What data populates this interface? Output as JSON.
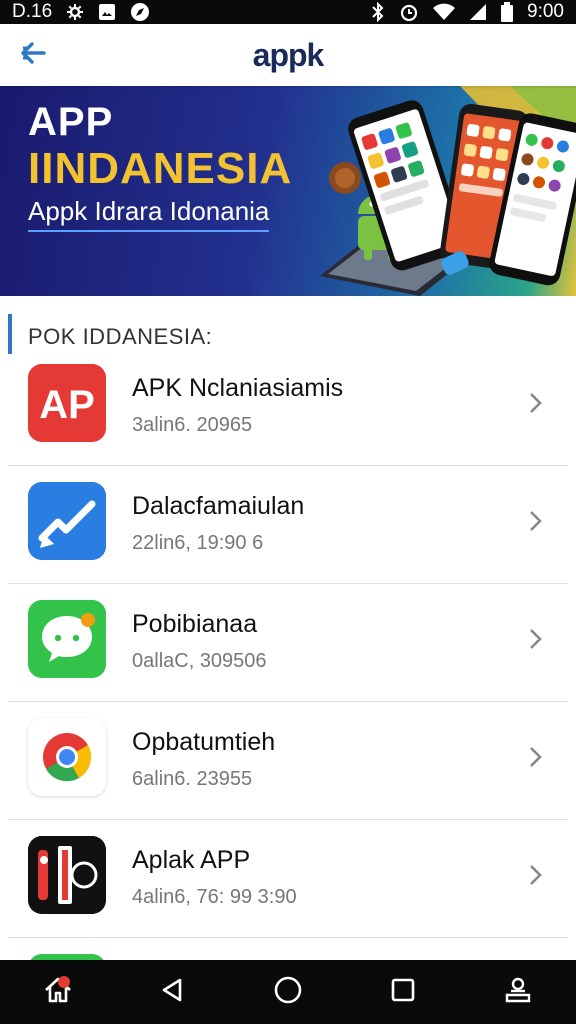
{
  "status_bar": {
    "time_left": "D.16",
    "time_right": "9:00",
    "left_icons": [
      "gear-icon",
      "image-icon",
      "compass-icon"
    ],
    "right_icons": [
      "bluetooth-icon",
      "alarm-icon",
      "wifi-icon",
      "signal-icon",
      "battery-icon"
    ]
  },
  "app_bar": {
    "title": "appk",
    "back_icon": "back-arrow-icon"
  },
  "banner": {
    "title_line1": "APP",
    "title_line2": "IINDANESIA",
    "subtitle": "Appk Idrara Idonania",
    "colors": {
      "title_line2": "#f3c230",
      "background_start": "#1a1a6e",
      "background_end": "#e6c23a"
    }
  },
  "section": {
    "title": "POK IDDANESIA:"
  },
  "apps": [
    {
      "name": "APK Nclaniasiamis",
      "meta": "3alin6. 20965",
      "icon": "ap-logo-icon",
      "icon_text": "AP",
      "color": "#e53935"
    },
    {
      "name": "Dalacfamaiulan",
      "meta": "22lin6, 19:90 6",
      "icon": "checkmark-pen-icon",
      "color": "#2a7de1"
    },
    {
      "name": "Pobibianaa",
      "meta": "0allaC, 309506",
      "icon": "chat-bubble-icon",
      "color": "#33c24a"
    },
    {
      "name": "Opbatumtieh",
      "meta": "6alin6. 23955",
      "icon": "chrome-icon",
      "color": "#ffffff"
    },
    {
      "name": "Aplak APP",
      "meta": "4alin6, 76: 99 3:90",
      "icon": "black-red-logo-icon",
      "color": "#111111"
    }
  ],
  "nav_bar": {
    "items": [
      "home-icon",
      "back-triangle-icon",
      "home-circle-icon",
      "recents-square-icon",
      "user-desk-icon"
    ],
    "badge": ""
  }
}
